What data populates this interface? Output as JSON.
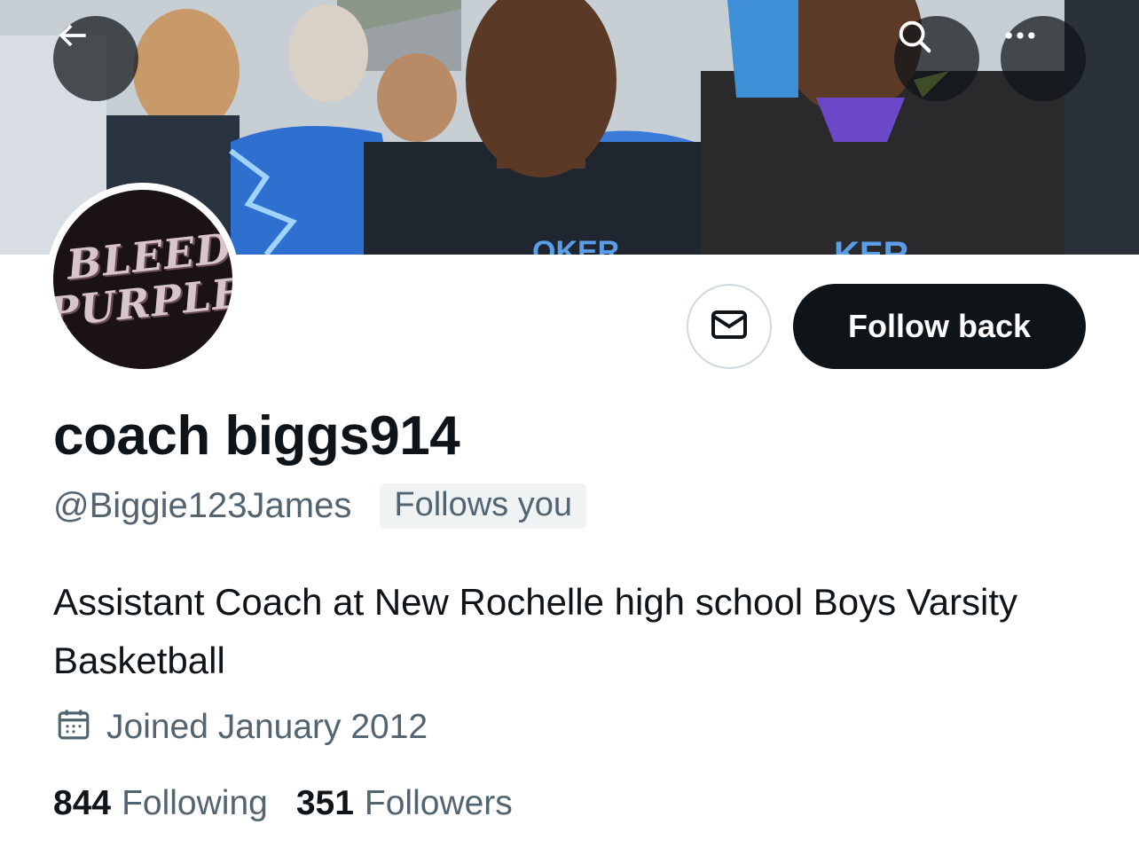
{
  "profile": {
    "display_name": "coach biggs914",
    "handle": "@Biggie123James",
    "follows_you": "Follows you",
    "bio": "Assistant Coach at New Rochelle high school Boys Varsity Basketball",
    "joined": "Joined January 2012",
    "following_count": "844",
    "following_label": "Following",
    "followers_count": "351",
    "followers_label": "Followers"
  },
  "avatar": {
    "line1": "BLEED",
    "line2": "PURPLE"
  },
  "actions": {
    "follow_back_label": "Follow back"
  },
  "icons": {
    "back": "back-arrow-icon",
    "search": "search-icon",
    "more": "more-icon",
    "message": "envelope-icon",
    "calendar": "calendar-icon"
  },
  "colors": {
    "primary_text": "#0f1419",
    "secondary_text": "#536471",
    "badge_bg": "#eff3f4",
    "button_dark": "#0f1419",
    "border": "#cfd9de"
  }
}
